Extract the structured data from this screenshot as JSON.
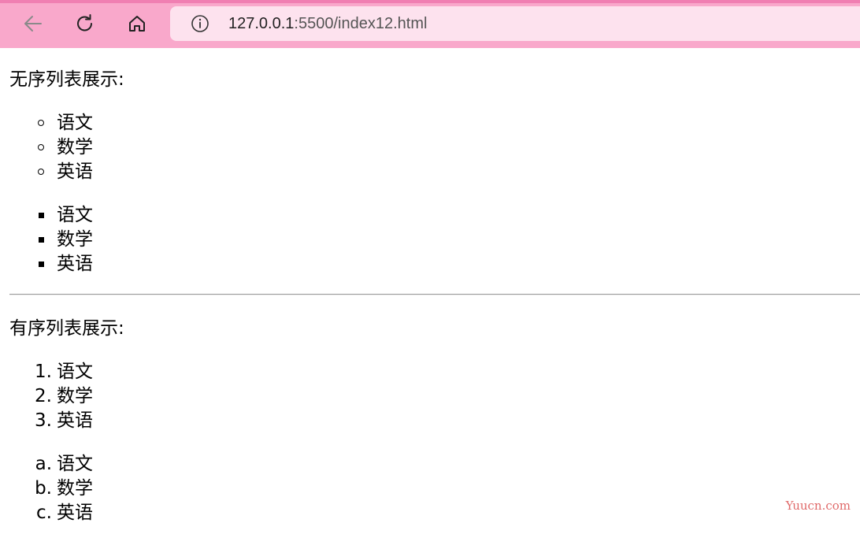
{
  "browser": {
    "back_icon": "arrow-left-icon",
    "reload_icon": "reload-icon",
    "home_icon": "home-icon",
    "info_icon": "info-icon",
    "url_host": "127.0.0.1",
    "url_path": ":5500/index12.html"
  },
  "page": {
    "unordered_heading": "无序列表展示:",
    "unordered_list_circle": {
      "marker": "circle",
      "items": [
        "语文",
        "数学",
        "英语"
      ]
    },
    "unordered_list_square": {
      "marker": "square",
      "items": [
        "语文",
        "数学",
        "英语"
      ]
    },
    "ordered_heading": "有序列表展示:",
    "ordered_list_numeric": {
      "markers": [
        "1.",
        "2.",
        "3."
      ],
      "items": [
        "语文",
        "数学",
        "英语"
      ]
    },
    "ordered_list_alpha": {
      "markers": [
        "a.",
        "b.",
        "c."
      ],
      "items": [
        "语文",
        "数学",
        "英语"
      ]
    }
  },
  "watermark": "Yuucn.com"
}
